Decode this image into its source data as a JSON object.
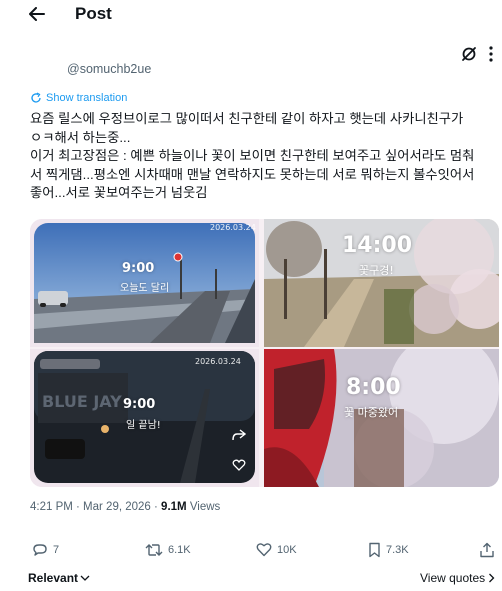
{
  "header": {
    "title": "Post"
  },
  "post": {
    "username": "@somuchb2ue",
    "show_translation": "Show translation",
    "text_line1": "요즘 릴스에 우정브이로그 많이떠서 친구한테 같이 하자고 햇는데 사카니친구가",
    "text_line2": "ㅇㅋ해서 하는중...",
    "text_line3": "이거 최고장점은 : 예쁜 하늘이나 꽃이 보이면 친구한테 보여주고 싶어서라도 멈춰",
    "text_line4": "서 찍게댐...평소엔 시차때매 맨날 연락하지도 못하는데 서로 뭐하는지 볼수잇어서",
    "text_line5": "좋어...서로 꽃보여주는거 넘웃김"
  },
  "media": {
    "top_left": {
      "date": "2026.03.24",
      "time": "9:00",
      "caption": "오늘도 달리"
    },
    "top_right": {
      "time": "14:00",
      "caption": "꽃구경!"
    },
    "bottom_left": {
      "date": "2026.03.24",
      "time": "9:00",
      "caption": "일 끝남!"
    },
    "bottom_right": {
      "time": "8:00",
      "caption": "꽃 마중왔어"
    }
  },
  "meta": {
    "timestamp": "4:21 PM · Mar 29, 2026 · ",
    "views_count": "9.1M",
    "views_label": " Views"
  },
  "actions": {
    "replies": "7",
    "reposts": "6.1K",
    "likes": "10K",
    "bookmarks": "7.3K"
  },
  "footer": {
    "relevant": "Relevant",
    "view_quotes": "View quotes"
  },
  "colors": {
    "accent": "#1d9bf0",
    "secondary_text": "#536471",
    "primary_text": "#0f1419"
  }
}
